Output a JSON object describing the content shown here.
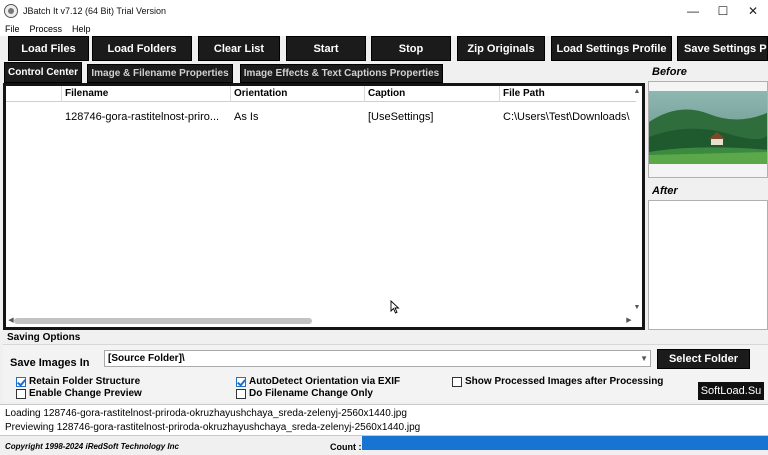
{
  "window": {
    "title": "JBatch It v7.12 (64 Bit) Trial Version",
    "controls": {
      "minimize": "—",
      "maximize": "☐",
      "close": "✕"
    }
  },
  "menu": [
    "File",
    "Process",
    "Help"
  ],
  "toolbar": [
    "Load Files",
    "Load Folders",
    "Clear List",
    "Start",
    "Stop",
    "Zip Originals",
    "Load Settings Profile",
    "Save Settings Pr"
  ],
  "tabs": [
    "Control Center",
    "Image & Filename Properties",
    "Image Effects & Text Captions Properties"
  ],
  "file_list": {
    "columns": [
      "",
      "Filename",
      "Orientation",
      "Caption",
      "File Path"
    ],
    "rows": [
      [
        "",
        "128746-gora-rastitelnost-priro...",
        "As Is",
        "[UseSettings]",
        "C:\\Users\\Test\\Downloads\\"
      ]
    ]
  },
  "preview": {
    "before_label": "Before",
    "after_label": "After"
  },
  "saving": {
    "section_label": "Saving Options",
    "save_in_label": "Save Images In",
    "folder_value": "[Source Folder]\\",
    "select_button": "Select Folder",
    "options": [
      {
        "label": "Retain Folder Structure",
        "checked": true
      },
      {
        "label": "Enable Change Preview",
        "checked": false
      },
      {
        "label": "AutoDetect Orientation via EXIF",
        "checked": true
      },
      {
        "label": "Do Filename Change Only",
        "checked": false
      },
      {
        "label": "Show Processed Images after Processing",
        "checked": false
      }
    ]
  },
  "watermark": "SoftLoad.Su",
  "log": [
    "Loading 128746-gora-rastitelnost-priroda-okruzhayushchaya_sreda-zelenyj-2560x1440.jpg",
    "Previewing 128746-gora-rastitelnost-priroda-okruzhayushchaya_sreda-zelenyj-2560x1440.jpg"
  ],
  "status": {
    "copyright": "Copyright 1998-2024 iRedSoft Technology Inc",
    "count_label": "Count :",
    "progress_fraction": 1.0
  },
  "colors": {
    "accent": "#1774d2",
    "button_bg": "#1b1b1b",
    "check": "#1f6fc9"
  },
  "icons": [
    "app-icon",
    "minimize-icon",
    "maximize-icon",
    "close-icon",
    "chevron-down-icon",
    "mouse-pointer-icon"
  ]
}
